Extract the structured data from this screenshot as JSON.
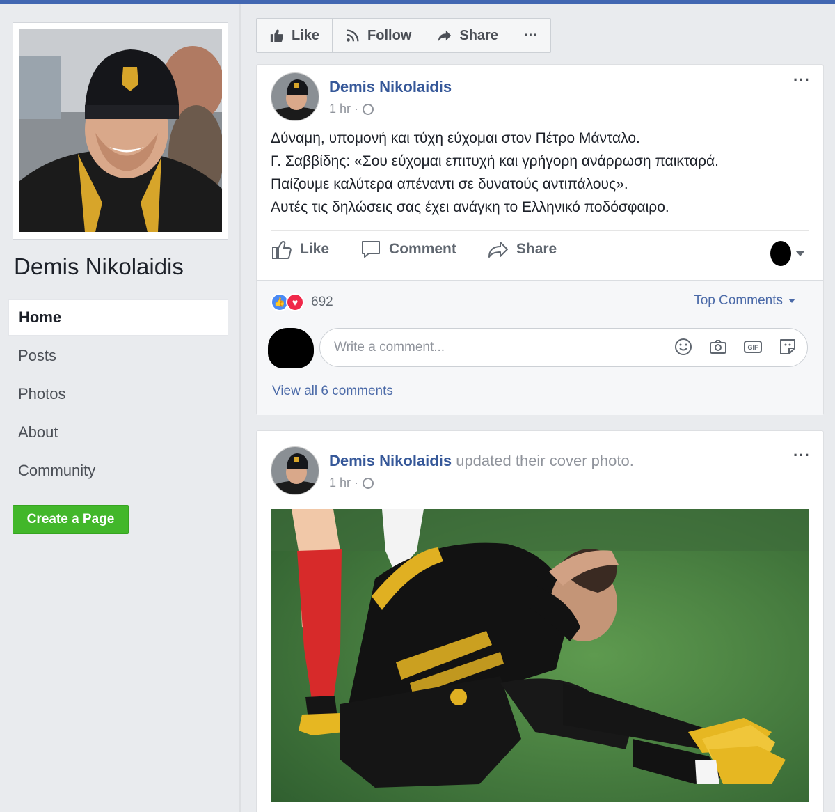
{
  "page": {
    "name": "Demis Nikolaidis"
  },
  "sidebar": {
    "items": [
      {
        "label": "Home",
        "active": true
      },
      {
        "label": "Posts"
      },
      {
        "label": "Photos"
      },
      {
        "label": "About"
      },
      {
        "label": "Community"
      }
    ],
    "create_page_label": "Create a Page"
  },
  "actions": {
    "like": "Like",
    "follow": "Follow",
    "share": "Share",
    "more": "···"
  },
  "post1": {
    "author": "Demis Nikolaidis",
    "time": "1 hr ·",
    "lines": [
      "Δύναμη, υπομονή και τύχη εύχομαι στον Πέτρο Μάνταλο.",
      "Γ. Σαββίδης: «Σου εύχομαι επιτυχή και γρήγορη ανάρρωση παικταρά.",
      "Παίζουμε καλύτερα απέναντι σε δυνατούς αντιπάλους».",
      "Αυτές τις δηλώσεις σας έχει ανάγκη το Ελληνικό ποδόσφαιρο."
    ],
    "like_label": "Like",
    "comment_label": "Comment",
    "share_label": "Share",
    "reaction_count": "692",
    "top_comments_label": "Top Comments",
    "comment_placeholder": "Write a comment...",
    "view_all_label": "View all 6 comments"
  },
  "post2": {
    "author": "Demis Nikolaidis",
    "action_text": "updated their cover photo.",
    "time": "1 hr ·"
  },
  "colors": {
    "brand": "#4267b2",
    "link": "#365899",
    "create_button": "#42b72a"
  }
}
